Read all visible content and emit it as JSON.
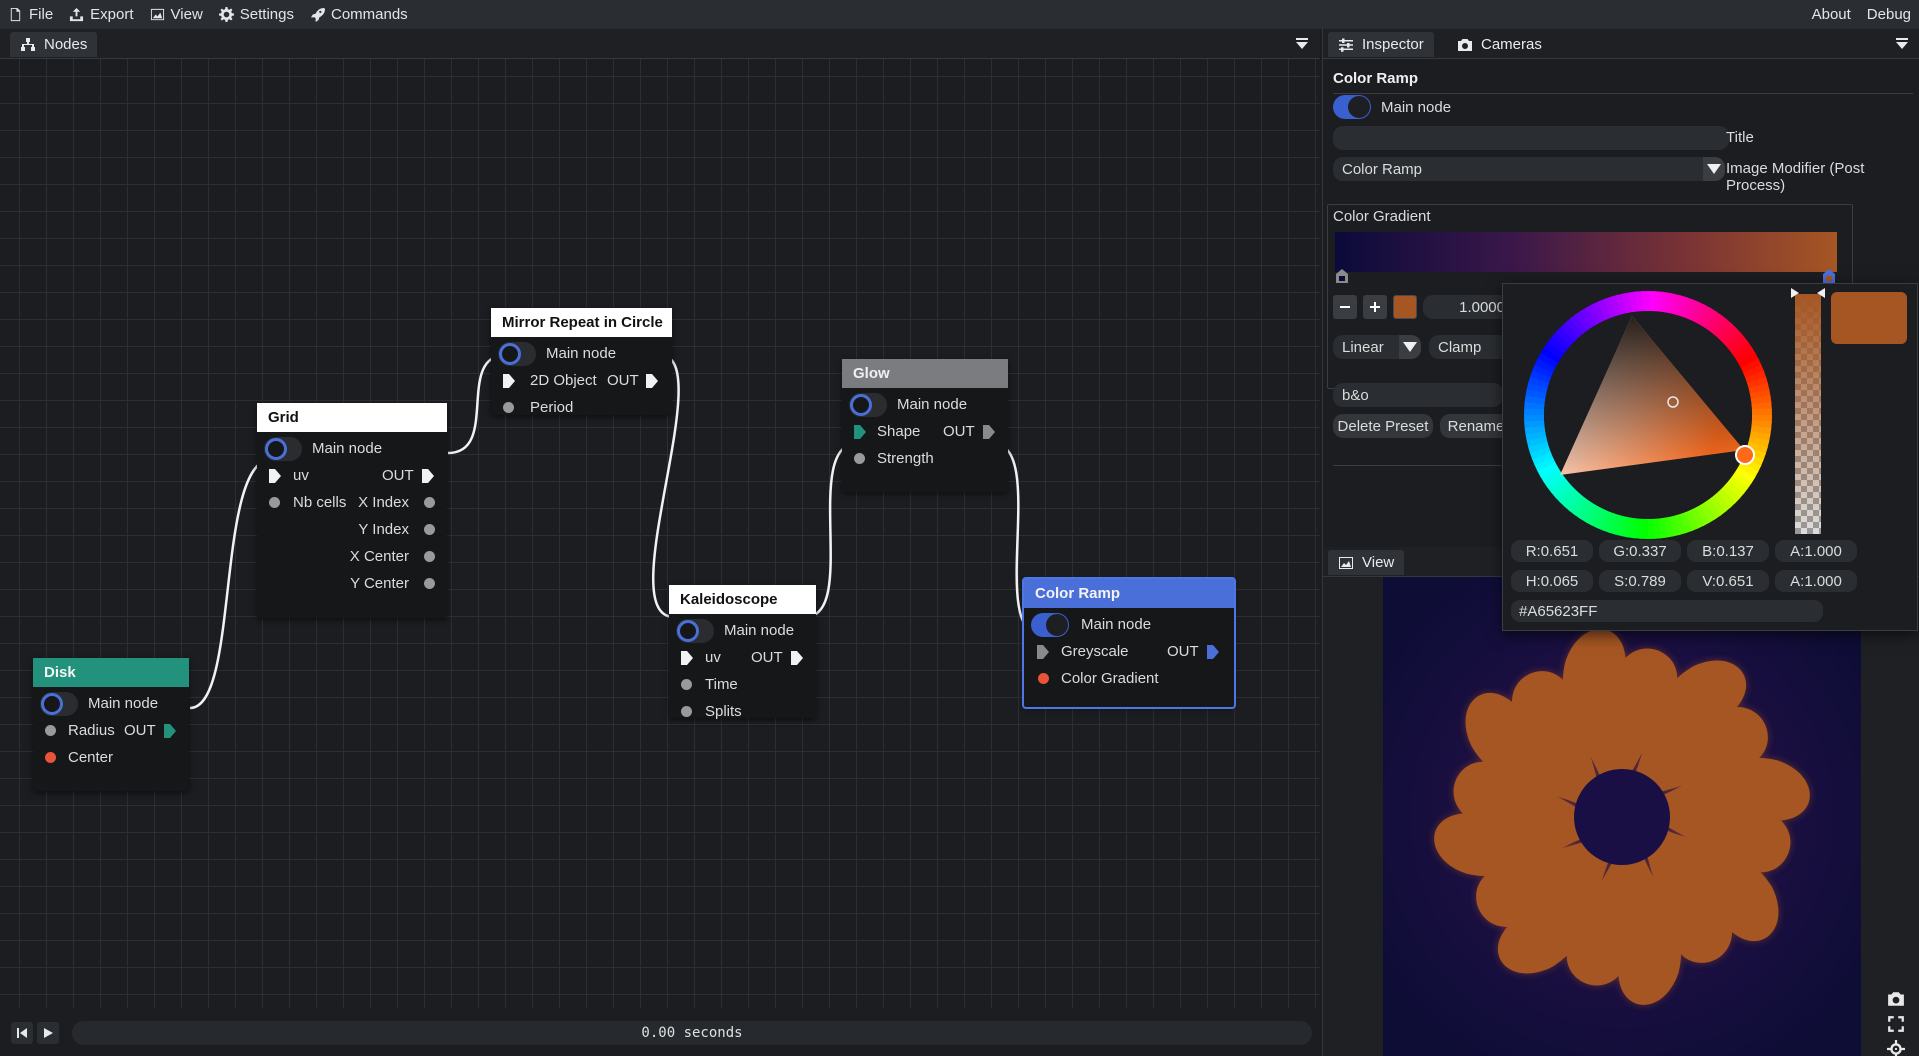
{
  "menubar": {
    "left": [
      {
        "label": "File",
        "icon": "file-icon"
      },
      {
        "label": "Export",
        "icon": "export-icon"
      },
      {
        "label": "View",
        "icon": "image-icon"
      },
      {
        "label": "Settings",
        "icon": "gear-icon"
      },
      {
        "label": "Commands",
        "icon": "rocket-icon"
      }
    ],
    "right": [
      "About",
      "Debug"
    ]
  },
  "nodes_panel": {
    "tab_label": "Nodes",
    "nodes": {
      "disk": {
        "title": "Disk",
        "main_node": "Main node",
        "inputs": [
          "Radius",
          "Center"
        ],
        "out": "OUT"
      },
      "grid": {
        "title": "Grid",
        "main_node": "Main node",
        "inputs": [
          "uv",
          "Nb cells"
        ],
        "out": "OUT",
        "outputs": [
          "X Index",
          "Y Index",
          "X Center",
          "Y Center"
        ]
      },
      "mirror": {
        "title": "Mirror Repeat in Circle",
        "main_node": "Main node",
        "inputs": [
          "2D Object",
          "Period"
        ],
        "out": "OUT"
      },
      "kaleidoscope": {
        "title": "Kaleidoscope",
        "main_node": "Main node",
        "inputs": [
          "uv",
          "Time",
          "Splits"
        ],
        "out": "OUT"
      },
      "glow": {
        "title": "Glow",
        "main_node": "Main node",
        "inputs": [
          "Shape",
          "Strength"
        ],
        "out": "OUT"
      },
      "color_ramp": {
        "title": "Color Ramp",
        "main_node": "Main node",
        "inputs": [
          "Greyscale",
          "Color Gradient"
        ],
        "out": "OUT"
      }
    }
  },
  "timeline": {
    "time": "0.00 seconds"
  },
  "inspector": {
    "tabs": [
      "Inspector",
      "Cameras"
    ],
    "section_title": "Color Ramp",
    "main_node_label": "Main node",
    "title_field": {
      "value": "",
      "label": "Title"
    },
    "node_type": {
      "value": "Color Ramp",
      "label": "Image Modifier (Post Process)"
    },
    "gradient": {
      "label": "Color Gradient",
      "stop_value": "1.0000",
      "interpolation": "Linear",
      "wrap": "Clamp",
      "preset_name": "b&o",
      "delete_preset": "Delete Preset",
      "rename": "Rename",
      "stops": [
        "#0b0a3a",
        "#a65623"
      ]
    },
    "picker": {
      "r": "R:0.651",
      "g": "G:0.337",
      "b": "B:0.137",
      "a": "A:1.000",
      "h": "H:0.065",
      "s": "S:0.789",
      "v": "V:0.651",
      "a2": "A:1.000",
      "hex": "#A65623FF"
    }
  },
  "view": {
    "tab_label": "View"
  },
  "colors": {
    "accent": "#4a6fd8",
    "disk_header": "#22927c",
    "glow_header": "#7a7c80",
    "ramp_header": "#4a6fd8",
    "picked_color": "#a65623",
    "preview_bg": "#100f36"
  }
}
